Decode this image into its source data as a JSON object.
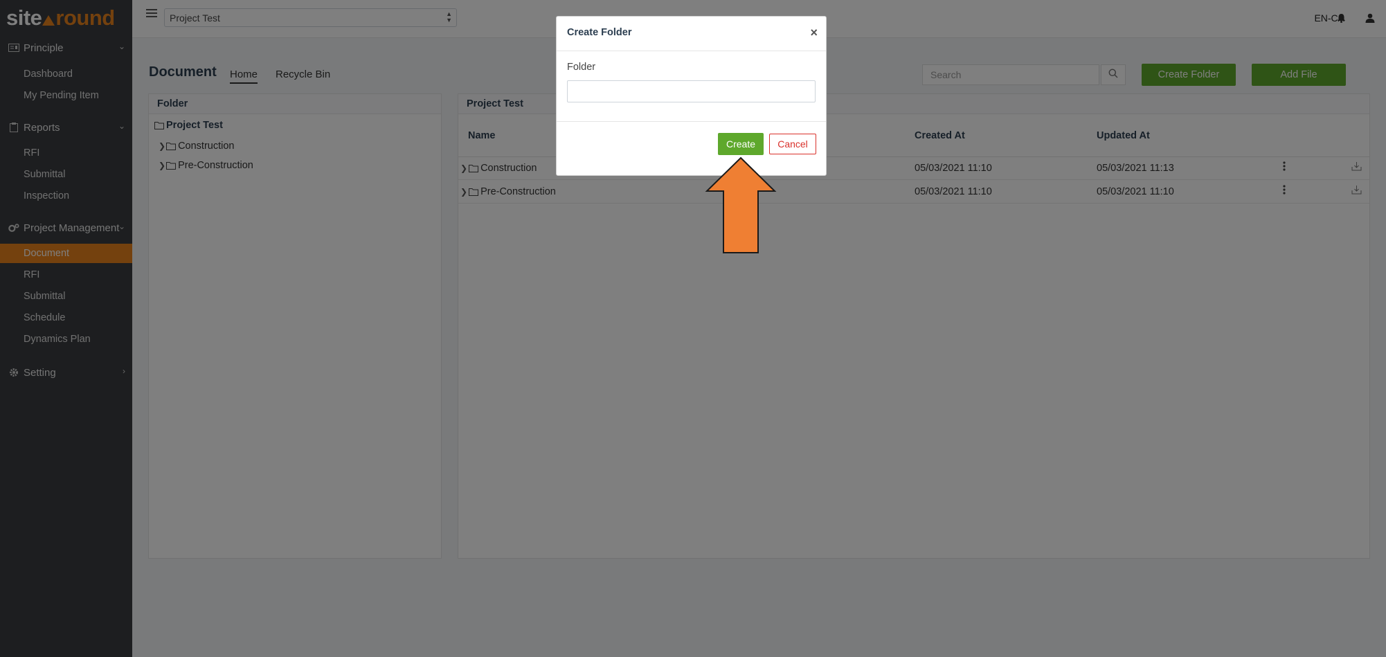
{
  "brand": {
    "part1": "site",
    "part2": "round"
  },
  "sidebar": {
    "sections": [
      {
        "label": "Principle",
        "items": [
          "Dashboard",
          "My Pending Item"
        ]
      },
      {
        "label": "Reports",
        "items": [
          "RFI",
          "Submittal",
          "Inspection"
        ]
      },
      {
        "label": "Project Management",
        "items": [
          "Document",
          "RFI",
          "Submittal",
          "Schedule",
          "Dynamics Plan"
        ]
      },
      {
        "label": "Setting",
        "items": []
      }
    ],
    "active_item": "Document"
  },
  "topbar": {
    "project_select": "Project Test",
    "language": "EN-CA"
  },
  "page": {
    "title": "Document",
    "tabs": [
      "Home",
      "Recycle Bin"
    ],
    "search_placeholder": "Search",
    "create_folder_label": "Create Folder",
    "add_file_label": "Add File"
  },
  "folder_panel": {
    "header": "Folder",
    "root": "Project Test",
    "children": [
      "Construction",
      "Pre-Construction"
    ]
  },
  "files_panel": {
    "header": "Project Test",
    "columns": [
      "Name",
      "Created At",
      "Updated At"
    ],
    "rows": [
      {
        "name": "Construction",
        "created": "05/03/2021 11:10",
        "updated": "05/03/2021 11:13"
      },
      {
        "name": "Pre-Construction",
        "created": "05/03/2021 11:10",
        "updated": "05/03/2021 11:10"
      }
    ]
  },
  "modal": {
    "title": "Create Folder",
    "close": "×",
    "field_label": "Folder",
    "field_value": "",
    "create_label": "Create",
    "cancel_label": "Cancel"
  },
  "colors": {
    "accent": "#e8821c",
    "primary_green": "#5ea82c",
    "danger": "#d9312b",
    "sidebar_bg": "#3a3d40",
    "arrow": "#ef7f33"
  }
}
